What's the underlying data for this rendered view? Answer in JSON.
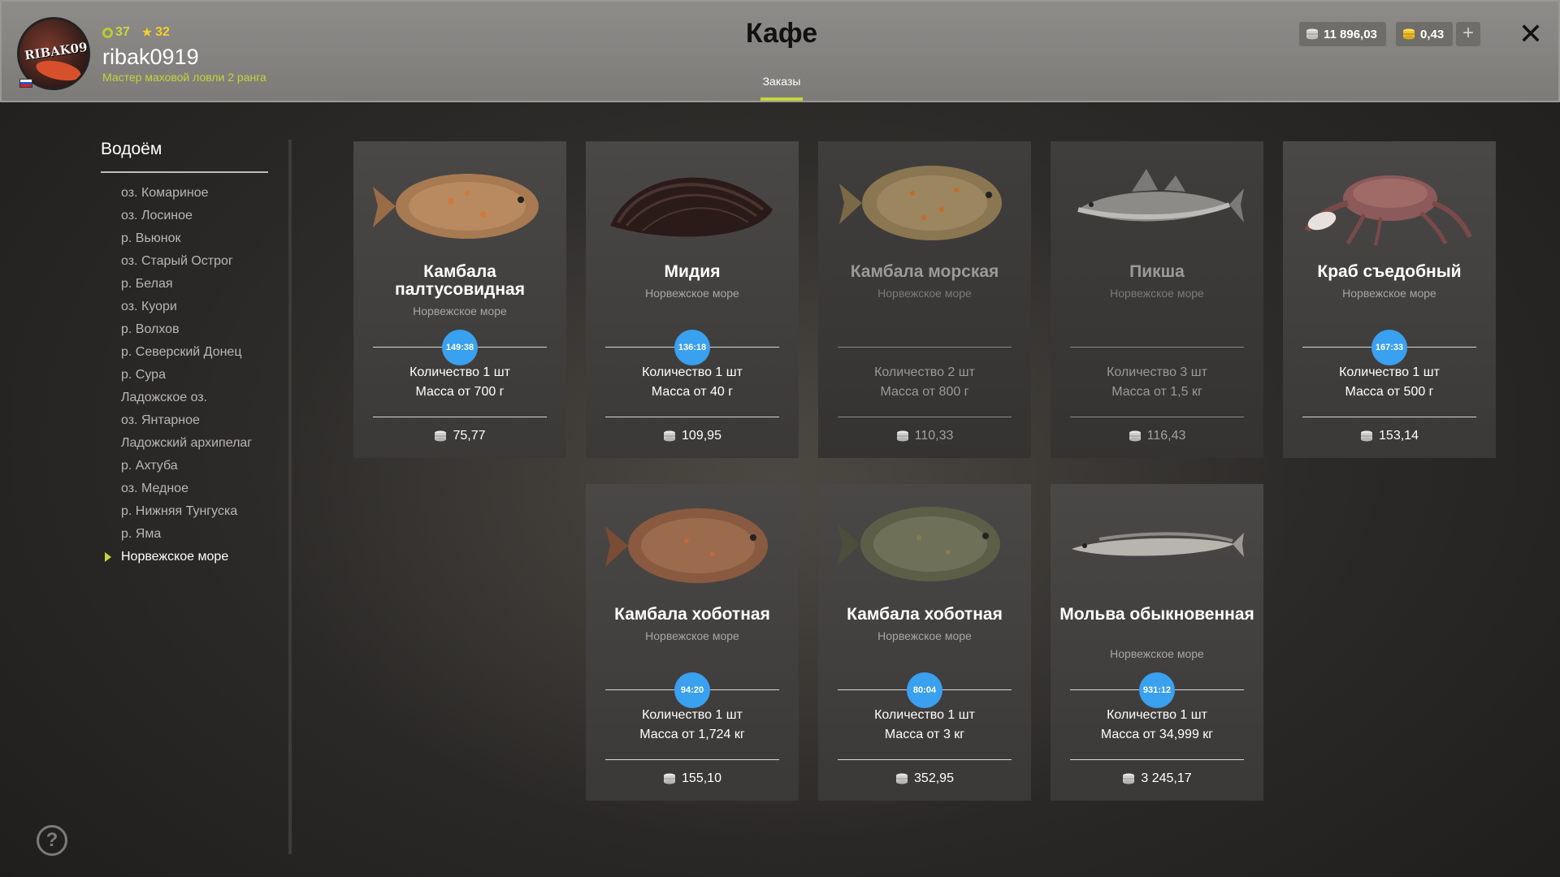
{
  "header": {
    "avatar_text": "RIBAK0919",
    "level": "37",
    "stars": "32",
    "username": "ribak0919",
    "rank": "Мастер маховой ловли 2 ранга",
    "title": "Кафе",
    "tab": "Заказы",
    "silver": "11 896,03",
    "gold": "0,43",
    "plus": "+",
    "close": "✕"
  },
  "sidebar": {
    "title": "Водоём",
    "items": [
      {
        "label": "оз. Комариное"
      },
      {
        "label": "оз. Лосиное"
      },
      {
        "label": "р. Вьюнок"
      },
      {
        "label": "оз. Старый Острог"
      },
      {
        "label": "р. Белая"
      },
      {
        "label": "оз. Куори"
      },
      {
        "label": "р. Волхов"
      },
      {
        "label": "р. Северский Донец"
      },
      {
        "label": "р. Сура"
      },
      {
        "label": "Ладожское оз."
      },
      {
        "label": "оз. Янтарное"
      },
      {
        "label": "Ладожский архипелаг"
      },
      {
        "label": "р. Ахтуба"
      },
      {
        "label": "оз. Медное"
      },
      {
        "label": "р. Нижняя Тунгуска"
      },
      {
        "label": "р. Яма"
      },
      {
        "label": "Норвежское море",
        "active": true
      }
    ]
  },
  "help": "?",
  "orders": [
    {
      "name": "Камбала палтусовидная",
      "region": "Норвежское море",
      "timer": "149:38",
      "qty": "Количество 1 шт",
      "mass": "Масса от 700 г",
      "price": "75,77",
      "icon": "flounder-icon",
      "available": true
    },
    {
      "name": "Мидия",
      "region": "Норвежское море",
      "timer": "136:18",
      "qty": "Количество 1 шт",
      "mass": "Масса от 40 г",
      "price": "109,95",
      "icon": "mussel-icon",
      "available": true
    },
    {
      "name": "Камбала морская",
      "region": "Норвежское море",
      "timer": "",
      "qty": "Количество 2 шт",
      "mass": "Масса от 800 г",
      "price": "110,33",
      "icon": "plaice-icon",
      "available": false
    },
    {
      "name": "Пикша",
      "region": "Норвежское море",
      "timer": "",
      "qty": "Количество 3 шт",
      "mass": "Масса от 1,5 кг",
      "price": "116,43",
      "icon": "haddock-icon",
      "available": false
    },
    {
      "name": "Краб съедобный",
      "region": "Норвежское море",
      "timer": "167:33",
      "qty": "Количество 1 шт",
      "mass": "Масса от 500 г",
      "price": "153,14",
      "icon": "crab-icon",
      "available": true
    },
    {
      "name": "Камбала хоботная",
      "region": "Норвежское море",
      "timer": "94:20",
      "qty": "Количество 1 шт",
      "mass": "Масса от 1,724 кг",
      "price": "155,10",
      "icon": "flounder-icon",
      "available": true
    },
    {
      "name": "Камбала хоботная",
      "region": "Норвежское море",
      "timer": "80:04",
      "qty": "Количество 1 шт",
      "mass": "Масса от 3 кг",
      "price": "352,95",
      "icon": "flounder-icon",
      "available": true
    },
    {
      "name": "Мольва обыкновенная",
      "region": "Норвежское море",
      "timer": "931:12",
      "qty": "Количество 1 шт",
      "mass": "Масса от 34,999 кг",
      "price": "3 245,17",
      "icon": "ling-icon",
      "available": true
    }
  ],
  "colors": {
    "accent": "#c6d43a",
    "timer": "#3aa0f0",
    "header": "#8a8885"
  }
}
